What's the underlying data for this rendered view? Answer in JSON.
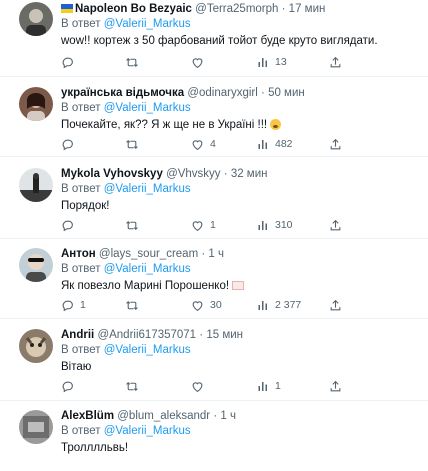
{
  "replies": [
    {
      "name": "Napoleon Bo Bezyaic",
      "handle": "@Terra25morph",
      "time": "17 мин",
      "flag": "ukraine-flag",
      "reply_prefix": "В ответ",
      "reply_to": "@Valerii_Markus",
      "text": "wow!! кортеж з 50 фарбований тойот буде круто виглядати.",
      "counts": {
        "reply": "",
        "retweet": "",
        "like": "",
        "views": "13"
      }
    },
    {
      "name": "українська відьмочка",
      "handle": "@odinaryxgirl",
      "time": "50 мин",
      "reply_prefix": "В ответ",
      "reply_to": "@Valerii_Markus",
      "text": "Почекайте, як?? Я ж ще не в Україні !!!",
      "emoji": "anxious-face",
      "counts": {
        "reply": "",
        "retweet": "",
        "like": "4",
        "views": "482"
      }
    },
    {
      "name": "Mykola Vyhovskyy",
      "handle": "@Vhvskyy",
      "time": "32 мин",
      "reply_prefix": "В ответ",
      "reply_to": "@Valerii_Markus",
      "text": "Порядок!",
      "counts": {
        "reply": "",
        "retweet": "",
        "like": "1",
        "views": "310"
      }
    },
    {
      "name": "Антон",
      "handle": "@lays_sour_cream",
      "time": "1 ч",
      "reply_prefix": "В ответ",
      "reply_to": "@Valerii_Markus",
      "text": "Як повезло Марині Порошенко!",
      "emoji": "love-letter",
      "counts": {
        "reply": "1",
        "retweet": "",
        "like": "30",
        "views": "2 377"
      }
    },
    {
      "name": "Andrii",
      "handle": "@Andrii617357071",
      "time": "15 мин",
      "reply_prefix": "В ответ",
      "reply_to": "@Valerii_Markus",
      "text": "Вітаю",
      "counts": {
        "reply": "",
        "retweet": "",
        "like": "",
        "views": "1"
      }
    },
    {
      "name": "AlexBlüm",
      "handle": "@blum_aleksandr",
      "time": "1 ч",
      "reply_prefix": "В ответ",
      "reply_to": "@Valerii_Markus",
      "text": "Тролллльвь!",
      "counts": {
        "reply": "",
        "retweet": "",
        "like": "",
        "views": ""
      }
    }
  ],
  "separator": "·",
  "colors": {
    "link": "#1d9bf0",
    "secondary": "#536471",
    "text": "#0f1419",
    "divider": "#eff3f4"
  }
}
